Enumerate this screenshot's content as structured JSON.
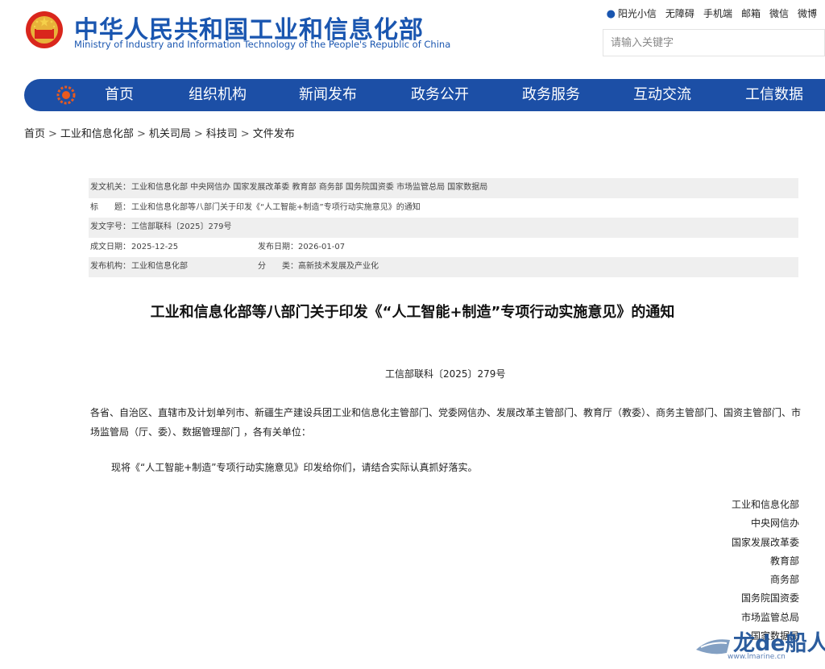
{
  "header": {
    "title_cn": "中华人民共和国工业和信息化部",
    "title_en": "Ministry of Industry and Information Technology of the People's Republic of China",
    "emblem_icon": "national-emblem-icon",
    "brand_color": "#1a56b0",
    "top_links": [
      "阳光小信",
      "无障碍",
      "手机端",
      "邮箱",
      "微信",
      "微博"
    ],
    "search": {
      "placeholder": "请输入关键字",
      "value": ""
    }
  },
  "nav": {
    "color": "#1c4fa6",
    "logo_icon": "miit-logo-icon",
    "items": [
      "首页",
      "组织机构",
      "新闻发布",
      "政务公开",
      "政务服务",
      "互动交流",
      "工信数据"
    ]
  },
  "breadcrumb": [
    "首页",
    "工业和信息化部",
    "机关司局",
    "科技司",
    "文件发布"
  ],
  "meta": {
    "issuer": {
      "label": "发文机关：",
      "value": "工业和信息化部 中央网信办 国家发展改革委 教育部 商务部 国务院国资委 市场监管总局 国家数据局"
    },
    "subject": {
      "label": "标　　题：",
      "value": "工业和信息化部等八部门关于印发《“人工智能+制造”专项行动实施意见》的通知"
    },
    "doc_no": {
      "label": "发文字号：",
      "value": "工信部联科〔2025〕279号"
    },
    "created": {
      "label": "成文日期：",
      "value": "2025-12-25"
    },
    "published": {
      "label": "发布日期：",
      "value": "2026-01-07"
    },
    "org": {
      "label": "发布机构：",
      "value": "工业和信息化部"
    },
    "category": {
      "label": "分　　类：",
      "value": "高新技术发展及产业化"
    }
  },
  "article": {
    "title": "工业和信息化部等八部门关于印发《“人工智能+制造”专项行动实施意见》的通知",
    "doc_number": "工信部联科〔2025〕279号",
    "recipients": "各省、自治区、直辖市及计划单列市、新疆生产建设兵团工业和信息化主管部门、党委网信办、发展改革主管部门、教育厅（教委）、商务主管部门、国资主管部门、市场监管局（厅、委）、数据管理部门 ，各有关单位：",
    "body": "现将《“人工智能+制造”专项行动实施意见》印发给你们，请结合实际认真抓好落实。",
    "signers": [
      "工业和信息化部",
      "中央网信办",
      "国家发展改革委",
      "教育部",
      "商务部",
      "国务院国资委",
      "市场监管总局",
      "国家数据局"
    ]
  },
  "watermark": {
    "text": "龙de船人",
    "url": "www.lmarine.cn",
    "icon": "ship-logo-icon"
  }
}
